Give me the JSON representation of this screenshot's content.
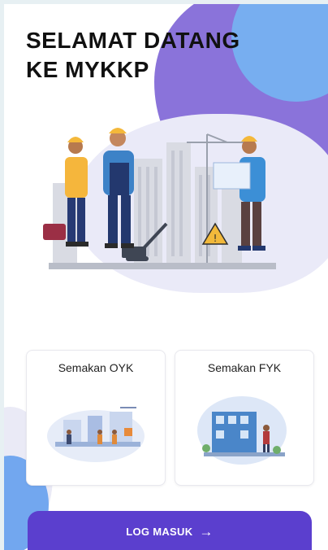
{
  "welcome": {
    "title_line1": "SELAMAT DATANG",
    "title_line2": "KE MYKKP"
  },
  "options": [
    {
      "label": "Semakan OYK",
      "icon": "factory-workers-illustration"
    },
    {
      "label": "Semakan FYK",
      "icon": "construction-site-illustration"
    }
  ],
  "login_button": {
    "label": "LOG MASUK",
    "icon": "arrow-right-icon"
  },
  "colors": {
    "accent_purple": "#5b3fce",
    "blob_purple": "#8a73da",
    "blob_blue": "#77aef0"
  }
}
